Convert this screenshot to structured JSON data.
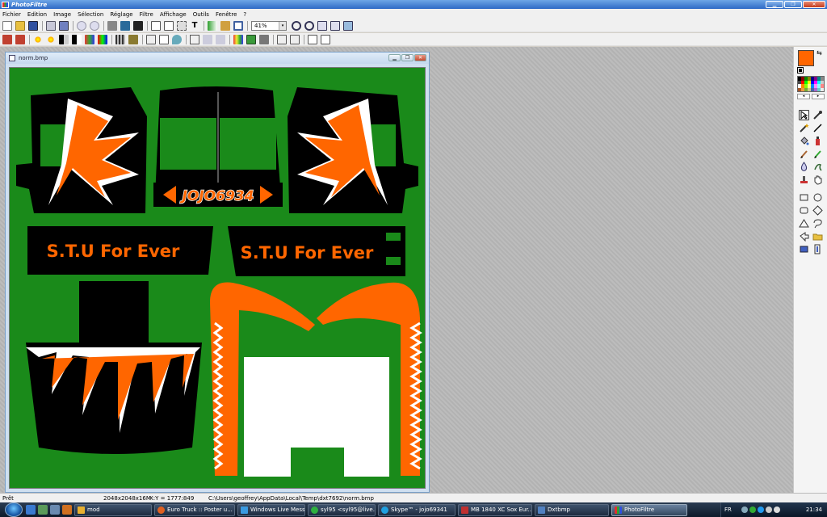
{
  "app": {
    "title": "PhotoFiltre"
  },
  "menu": [
    "Fichier",
    "Edition",
    "Image",
    "Sélection",
    "Réglage",
    "Filtre",
    "Affichage",
    "Outils",
    "Fenêtre",
    "?"
  ],
  "toolbar": {
    "zoom_value": "41%",
    "zoom_arrow": "▾"
  },
  "document": {
    "name": "norm.bmp",
    "art": {
      "plate_text": "JOJO6934",
      "side_text_left": "S.T.U For Ever",
      "side_text_right": "S.T.U For Ever"
    }
  },
  "status": {
    "state": "Prêt",
    "image_info": "2048x2048x16M",
    "coords": "X:Y = 1777:849",
    "path": "C:\\Users\\geoffrey\\AppData\\Local\\Temp\\dxt7692\\norm.bmp"
  },
  "taskbar": {
    "items": [
      {
        "label": "mod",
        "color": "#e8b030"
      },
      {
        "label": "Euro Truck :: Poster u...",
        "color": "#e06020"
      },
      {
        "label": "Windows Live Messe...",
        "color": "#3a9ae0"
      },
      {
        "label": "syl95 <syl95@live.fr>",
        "color": "#30b040"
      },
      {
        "label": "Skype™ - jojo69341",
        "color": "#20a0e0"
      },
      {
        "label": "MB 1840 XC Sox Eur...",
        "color": "#c03030"
      },
      {
        "label": "Dxtbmp",
        "color": "#5080c0"
      },
      {
        "label": "PhotoFiltre",
        "color": "#e04040",
        "active": true
      }
    ],
    "tray": {
      "lang": "FR",
      "time": "21:34"
    }
  },
  "colors": {
    "foreground": "#ff6600",
    "background": "#ffffff",
    "canvas_green": "#1a8a1a",
    "orange": "#ff6600"
  }
}
